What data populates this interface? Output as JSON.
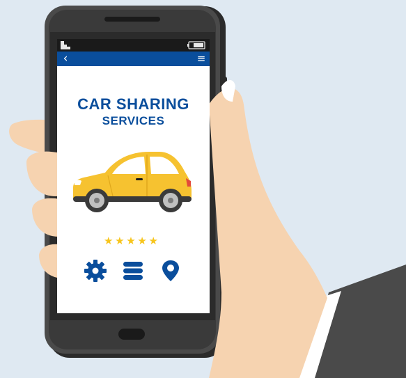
{
  "app": {
    "title": "CAR SHARING",
    "subtitle": "SERVICES"
  },
  "nav": {
    "back_glyph": "‹",
    "menu_glyph": "≡"
  },
  "rating": {
    "stars": 5,
    "glyph": "★"
  },
  "icons": {
    "status": [
      "signal-icon",
      "battery-icon"
    ],
    "actions": [
      "gear-icon",
      "list-icon",
      "location-pin-icon"
    ]
  },
  "colors": {
    "brand_blue": "#0a4e9c",
    "car_yellow": "#f6c230",
    "star_gold": "#f7c51c",
    "phone_body": "#3b3b3b",
    "skin": "#f6d3b0",
    "sleeve": "#4a4a4a",
    "background": "#dfe9f2"
  }
}
